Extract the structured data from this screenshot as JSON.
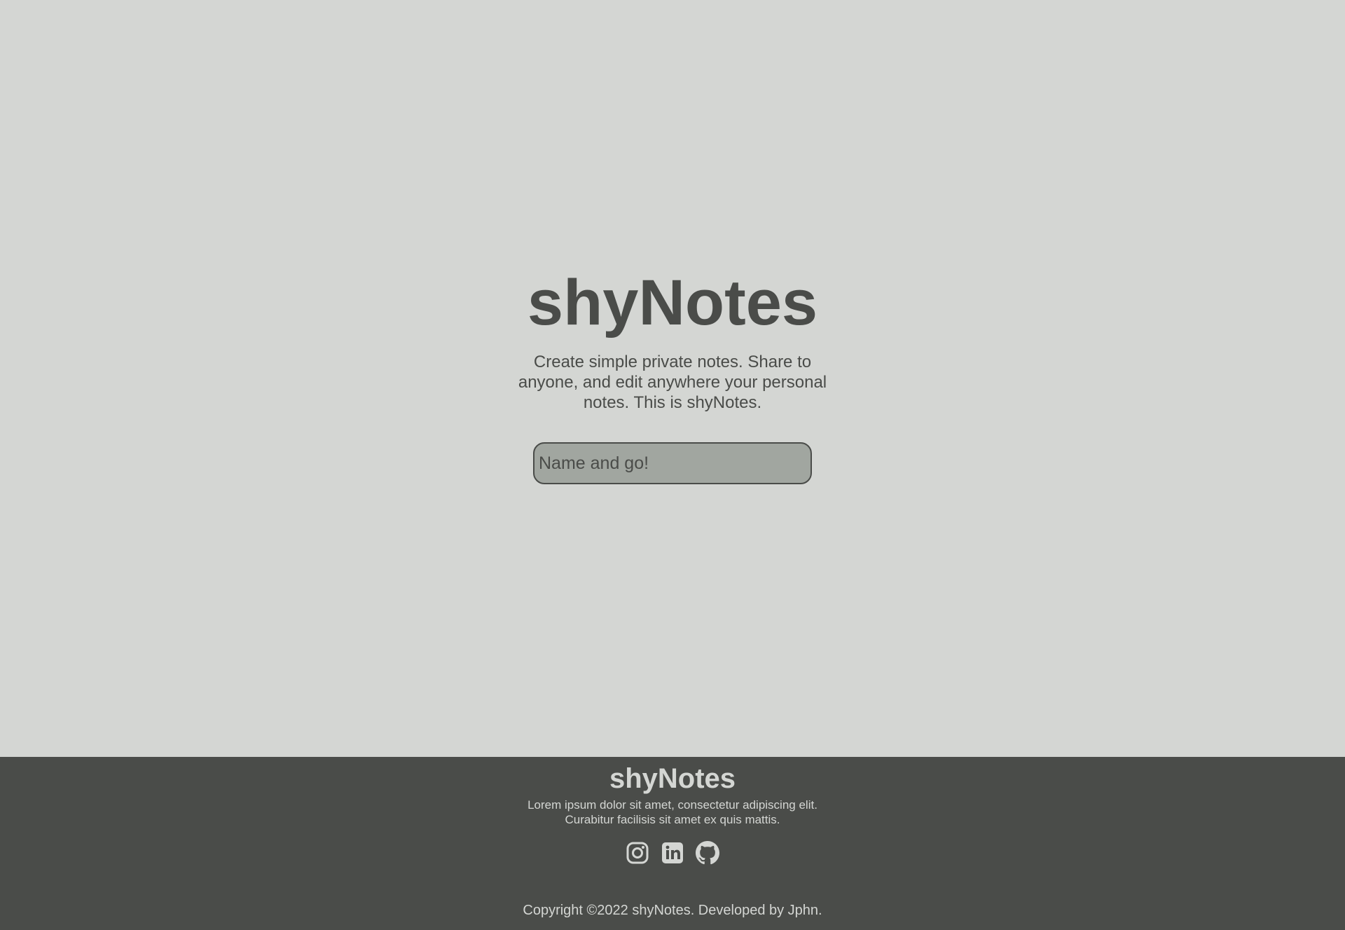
{
  "hero": {
    "title": "shyNotes",
    "description": "Create simple private notes. Share to anyone, and edit anywhere your personal notes. This is shyNotes.",
    "input_placeholder": "Name and go!"
  },
  "footer": {
    "title": "shyNotes",
    "description_line1": "Lorem ipsum dolor sit amet, consectetur adipiscing elit.",
    "description_line2": "Curabitur facilisis sit amet ex quis mattis.",
    "social_icons": [
      "instagram-icon",
      "linkedin-icon",
      "github-icon"
    ],
    "copyright": "Copyright ©2022 shyNotes. Developed by Jphn."
  },
  "colors": {
    "background": "#d4d6d3",
    "text_dark": "#4a4c49",
    "input_fill": "#a1a6a0",
    "footer_bg": "#4a4c49",
    "footer_text": "#d4d6d3"
  }
}
